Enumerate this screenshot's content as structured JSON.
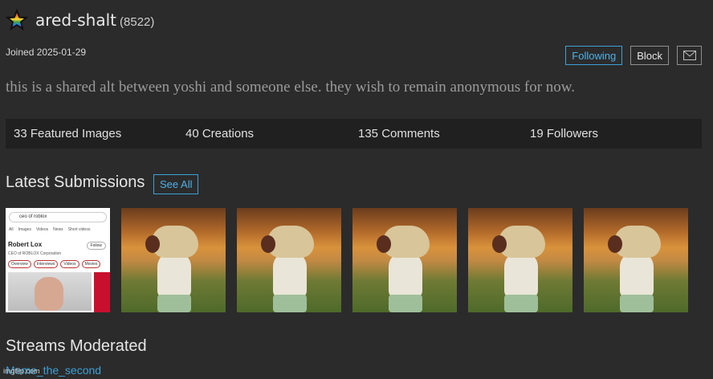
{
  "profile": {
    "username": "ared-shalt",
    "points": "(8522)",
    "joined": "Joined 2025-01-29",
    "bio": "this is a shared alt between yoshi and someone else. they wish to remain anonymous for now."
  },
  "actions": {
    "following_label": "Following",
    "block_label": "Block",
    "message_icon": "envelope-icon"
  },
  "stats": {
    "featured": "33 Featured Images",
    "creations": "40 Creations",
    "comments": "135 Comments",
    "followers": "19 Followers"
  },
  "latest": {
    "title": "Latest Submissions",
    "see_all": "See All",
    "thumbnails": [
      {
        "kind": "screenshot",
        "search_text": "ceo of roblox",
        "tabs": [
          "All",
          "Images",
          "Videos",
          "News",
          "Short videos"
        ],
        "name": "Robert Lox",
        "subtitle": "CEO of ROBLOX Corporation",
        "follow_label": "Follow",
        "chips": [
          "Overview",
          "Interviews",
          "Videos",
          "Movies"
        ]
      },
      {
        "kind": "meme"
      },
      {
        "kind": "meme"
      },
      {
        "kind": "meme"
      },
      {
        "kind": "meme"
      },
      {
        "kind": "meme"
      }
    ]
  },
  "streams": {
    "title": "Streams Moderated",
    "items": [
      "Meme_the_second"
    ]
  },
  "watermark": "imgflip.com",
  "colors": {
    "background": "#2b2b2b",
    "stats_bar": "#202020",
    "accent": "#3da0d6",
    "bio_text": "#9a9a9a"
  }
}
